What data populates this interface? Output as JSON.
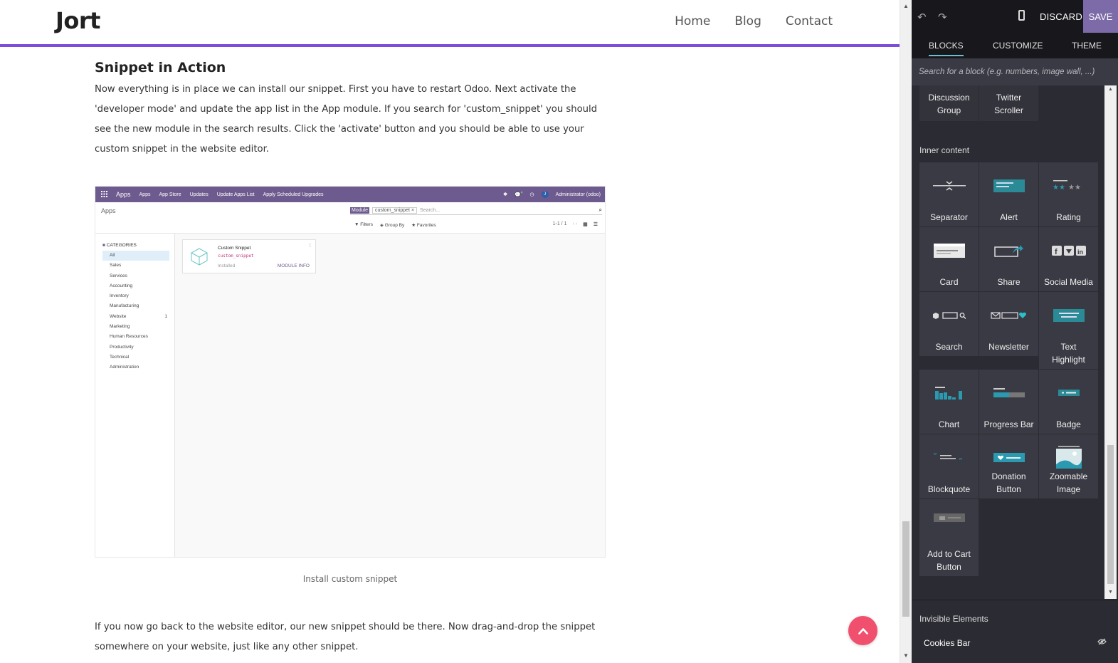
{
  "site": {
    "logo": "Jort",
    "nav": [
      "Home",
      "Blog",
      "Contact"
    ],
    "heading": "Snippet in Action",
    "paragraph1": "Now everything is in place we can install our snippet. First you have to restart Odoo. Next activate the 'developer mode' and update the app list in the App module. If you search for 'custom_snippet' you should see the new module in the search results. Click the 'activate' button and you should be able to use your custom snippet in the website editor.",
    "caption": "Install custom snippet",
    "paragraph2": "If you now go back to the website editor, our new snippet should be there. Now drag-and-drop the snippet somewhere on your website, just like any other snippet.",
    "accent_color": "#7c4ddb",
    "back_to_top_color": "#f0506e",
    "back_to_top_icon": "chevron-up-icon"
  },
  "screenshot": {
    "topbar": {
      "app": "Apps",
      "menu": [
        "Apps",
        "App Store",
        "Updates",
        "Update Apps List",
        "Apply Scheduled Upgrades"
      ],
      "chat_count": "4",
      "user": "Administrator (odoo)",
      "user_initial": "J"
    },
    "breadcrumb": "Apps",
    "search": {
      "facet_label": "Module",
      "facet_value": "custom_snippet",
      "placeholder": "Search..."
    },
    "filters": [
      "Filters",
      "Group By",
      "Favorites"
    ],
    "pager": "1-1 / 1",
    "categories_title": "CATEGORIES",
    "categories": [
      "All",
      "Sales",
      "Services",
      "Accounting",
      "Inventory",
      "Manufacturing",
      "Website",
      "Marketing",
      "Human Resources",
      "Productivity",
      "Technical",
      "Administration"
    ],
    "website_count": "1",
    "card": {
      "name": "Custom Snippet",
      "technical": "custom_snippet",
      "status": "Installed",
      "action": "MODULE INFO"
    }
  },
  "panel": {
    "discard": "DISCARD",
    "save": "SAVE",
    "tabs": [
      "BLOCKS",
      "CUSTOMIZE",
      "THEME"
    ],
    "search_placeholder": "Search for a block (e.g. numbers, image wall, ...)",
    "prev_blocks": [
      {
        "line1": "Discussion",
        "line2": "Group"
      },
      {
        "line1": "Twitter",
        "line2": "Scroller"
      }
    ],
    "inner_content_title": "Inner content",
    "blocks": [
      {
        "label": "Separator",
        "icon": "separator-icon"
      },
      {
        "label": "Alert",
        "icon": "alert-icon"
      },
      {
        "label": "Rating",
        "icon": "rating-icon"
      },
      {
        "label": "Card",
        "icon": "card-icon"
      },
      {
        "label": "Share",
        "icon": "share-icon"
      },
      {
        "label": "Social Media",
        "icon": "social-media-icon"
      },
      {
        "label": "Search",
        "icon": "search-block-icon"
      },
      {
        "label": "Newsletter",
        "icon": "newsletter-icon"
      },
      {
        "label": "Text Highlight",
        "icon": "text-highlight-icon"
      },
      {
        "label": "Chart",
        "icon": "chart-icon"
      },
      {
        "label": "Progress Bar",
        "icon": "progress-bar-icon"
      },
      {
        "label": "Badge",
        "icon": "badge-icon"
      },
      {
        "label": "Blockquote",
        "icon": "blockquote-icon"
      },
      {
        "label": "Donation Button",
        "icon": "donation-button-icon"
      },
      {
        "label": "Zoomable Image",
        "icon": "zoomable-image-icon"
      },
      {
        "label": "Add to Cart Button",
        "icon": "add-to-cart-icon"
      }
    ],
    "invisible_title": "Invisible Elements",
    "invisible_items": [
      "Cookies Bar"
    ],
    "save_color": "#7c6ba8",
    "tab_active_color": "#6bbfcf"
  }
}
